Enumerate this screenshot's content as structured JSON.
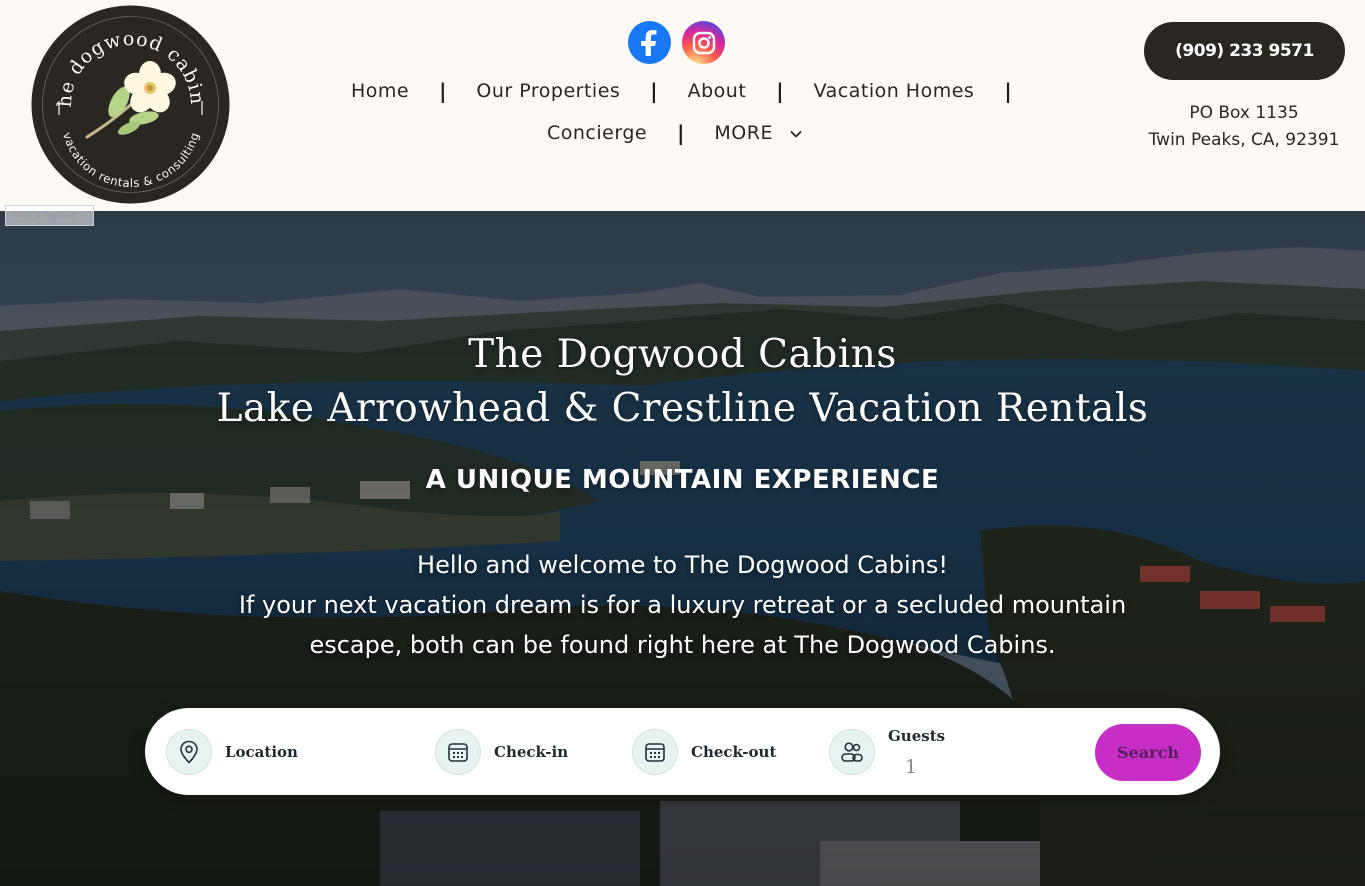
{
  "brand": {
    "logo_text_top": "the dogwood cabins",
    "logo_text_bottom": "vacation rentals & consulting",
    "logo_bg_color": "#2a2622",
    "flower_color": "#fff7e0",
    "leaf_color": "#b6d489"
  },
  "capture_overlay": "Start a capture",
  "social": [
    {
      "name": "facebook",
      "icon": "facebook-icon",
      "color": "#1877f2"
    },
    {
      "name": "instagram",
      "icon": "instagram-icon",
      "color": "#d6249f"
    }
  ],
  "nav": {
    "row1": [
      "Home",
      "Our Properties",
      "About",
      "Vacation Homes"
    ],
    "row2": [
      "Concierge",
      "MORE"
    ],
    "separator": "|"
  },
  "contact": {
    "phone": "(909) 233 9571",
    "address_line1": "PO Box 1135",
    "address_line2": "Twin Peaks, CA, 92391"
  },
  "hero": {
    "title_line1": "The Dogwood Cabins",
    "title_line2": "Lake Arrowhead & Crestline Vacation Rentals",
    "subtitle": "A UNIQUE MOUNTAIN EXPERIENCE",
    "body_line1": "Hello and welcome to The Dogwood Cabins!",
    "body_line2": "If your next vacation dream is for a luxury retreat or a secluded mountain",
    "body_line3": "escape, both can be found right here at The Dogwood Cabins."
  },
  "search": {
    "location_label": "Location",
    "checkin_label": "Check-in",
    "checkout_label": "Check-out",
    "guests_label": "Guests",
    "guests_value": "1",
    "button_label": "Search",
    "button_color": "#c72ec6",
    "icon_bg_color": "#e6f3f1"
  }
}
